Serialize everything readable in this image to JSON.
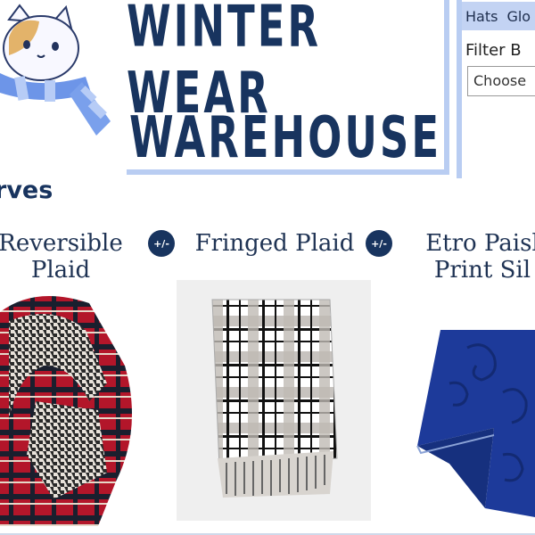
{
  "header": {
    "title_line1": "Winter Wear",
    "title_line2": "Warehouse"
  },
  "nav": {
    "items": [
      "Hats",
      "Glo"
    ]
  },
  "filter": {
    "label": "Filter B",
    "select_value": "Choose"
  },
  "section": {
    "title": "rves"
  },
  "products": [
    {
      "name_line1": "Reversible",
      "name_line2": "Plaid"
    },
    {
      "name_line1": "Fringed Plaid",
      "name_line2": ""
    },
    {
      "name_line1": "Etro Paisl",
      "name_line2": "Print Sil"
    }
  ],
  "toggle": {
    "label": "+/-"
  },
  "colors": {
    "brand_navy": "#18345f",
    "accent_blue": "#b9cdf2",
    "scarf_blue": "#1d3a9a",
    "plaid_red": "#b3162a"
  }
}
